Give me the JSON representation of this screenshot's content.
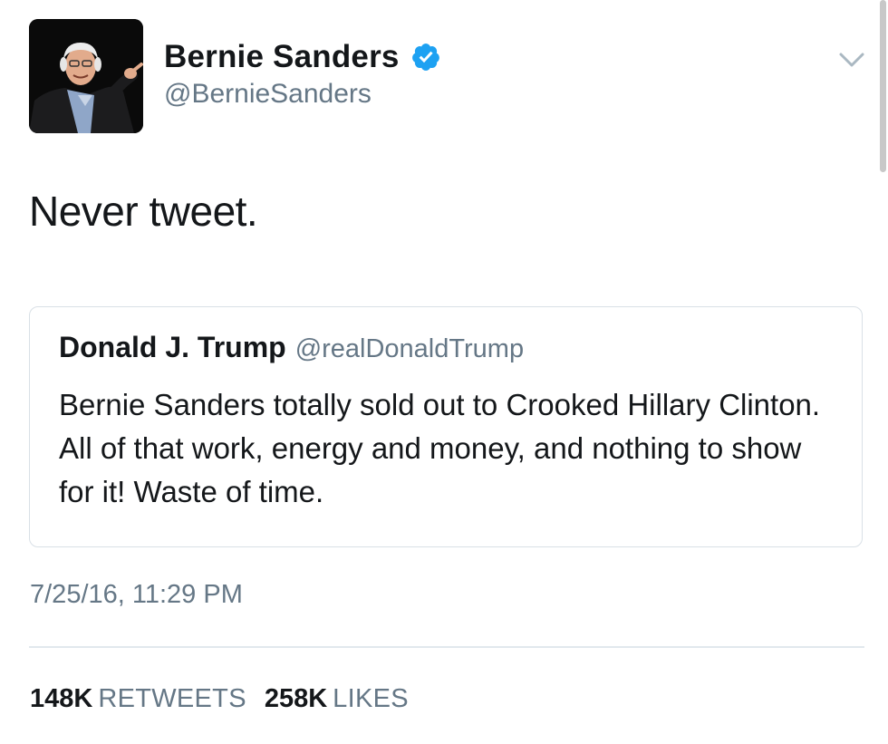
{
  "tweet": {
    "author": {
      "display_name": "Bernie Sanders",
      "handle": "@BernieSanders",
      "verified": true
    },
    "text": "Never tweet.",
    "quoted_tweet": {
      "display_name": "Donald J. Trump",
      "handle": "@realDonaldTrump",
      "text": "Bernie Sanders totally sold out to Crooked Hillary Clinton. All of that work, energy and money, and nothing to show for it! Waste of time."
    },
    "timestamp": "7/25/16, 11:29 PM",
    "stats": {
      "retweets_count": "148K",
      "retweets_label": "RETWEETS",
      "likes_count": "258K",
      "likes_label": "LIKES"
    }
  },
  "icons": {
    "verified": "verified-badge-icon",
    "menu": "chevron-down-icon"
  },
  "colors": {
    "verified_blue": "#1da1f2",
    "secondary_text": "#657786",
    "primary_text": "#14171a",
    "border": "#d9e0e6"
  }
}
